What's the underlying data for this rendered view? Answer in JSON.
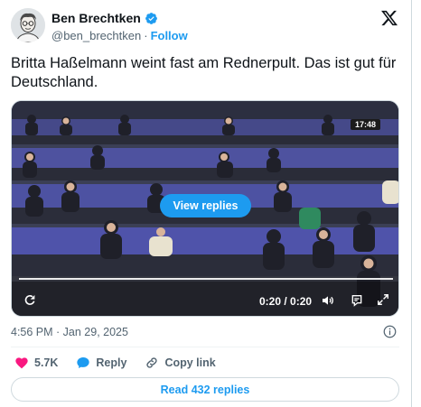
{
  "author": {
    "name": "Ben Brechtken",
    "handle": "@ben_brechtken",
    "separator": "·",
    "follow_label": "Follow"
  },
  "tweet": {
    "text": "Britta Haßelmann weint fast am Rednerpult. Das ist gut für Deutschland."
  },
  "video": {
    "broadcast_clock": "17:48",
    "overlay_button": "View replies",
    "time": "0:20 / 0:20",
    "progress_fraction": 1.0
  },
  "meta": {
    "timestamp": "4:56 PM · Jan 29, 2025"
  },
  "actions": {
    "likes": "5.7K",
    "reply_label": "Reply",
    "copy_label": "Copy link"
  },
  "read_replies_label": "Read 432 replies",
  "colors": {
    "accent": "#1d9bf0",
    "like": "#f91880",
    "text_secondary": "#536471"
  }
}
